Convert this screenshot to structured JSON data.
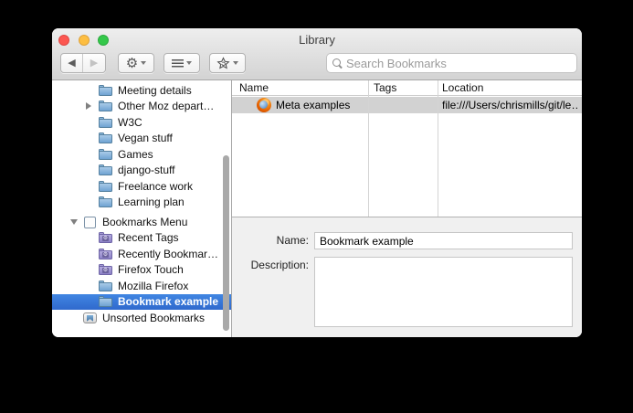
{
  "window": {
    "title": "Library"
  },
  "toolbar": {
    "back_icon": "◀",
    "forward_icon": "▶",
    "gear_icon": "⚙",
    "search_placeholder": "Search Bookmarks"
  },
  "sidebar": {
    "items": [
      {
        "label": "Meeting details",
        "icon": "folder",
        "level": 2,
        "disclosure": "none",
        "selected": false,
        "gap": false
      },
      {
        "label": "Other Moz depart…",
        "icon": "folder",
        "level": 2,
        "disclosure": "right",
        "selected": false,
        "gap": false
      },
      {
        "label": "W3C",
        "icon": "folder",
        "level": 2,
        "disclosure": "none",
        "selected": false,
        "gap": false
      },
      {
        "label": "Vegan stuff",
        "icon": "folder",
        "level": 2,
        "disclosure": "none",
        "selected": false,
        "gap": false
      },
      {
        "label": "Games",
        "icon": "folder",
        "level": 2,
        "disclosure": "none",
        "selected": false,
        "gap": false
      },
      {
        "label": "django-stuff",
        "icon": "folder",
        "level": 2,
        "disclosure": "none",
        "selected": false,
        "gap": false
      },
      {
        "label": "Freelance work",
        "icon": "folder",
        "level": 2,
        "disclosure": "none",
        "selected": false,
        "gap": false
      },
      {
        "label": "Learning plan",
        "icon": "folder",
        "level": 2,
        "disclosure": "none",
        "selected": false,
        "gap": false
      },
      {
        "label": "Bookmarks Menu",
        "icon": "menu",
        "level": 1,
        "disclosure": "down",
        "selected": false,
        "gap": true
      },
      {
        "label": "Recent Tags",
        "icon": "smart-folder",
        "level": 2,
        "disclosure": "none",
        "selected": false,
        "gap": false
      },
      {
        "label": "Recently Bookmar…",
        "icon": "smart-folder",
        "level": 2,
        "disclosure": "none",
        "selected": false,
        "gap": false
      },
      {
        "label": "Firefox Touch",
        "icon": "smart-folder",
        "level": 2,
        "disclosure": "none",
        "selected": false,
        "gap": false
      },
      {
        "label": "Mozilla Firefox",
        "icon": "folder",
        "level": 2,
        "disclosure": "none",
        "selected": false,
        "gap": false
      },
      {
        "label": "Bookmark example",
        "icon": "folder",
        "level": 2,
        "disclosure": "none",
        "selected": true,
        "gap": false
      },
      {
        "label": "Unsorted Bookmarks",
        "icon": "unsorted",
        "level": 1,
        "disclosure": "none",
        "selected": false,
        "gap": false
      }
    ]
  },
  "list": {
    "columns": [
      "Name",
      "Tags",
      "Location"
    ],
    "rows": [
      {
        "name": "Meta examples",
        "tags": "",
        "location": "file:///Users/chrismills/git/le…",
        "icon": "firefox"
      }
    ]
  },
  "details": {
    "name_label": "Name:",
    "name_value": "Bookmark example",
    "description_label": "Description:",
    "description_value": ""
  },
  "colors": {
    "selection_blue": "#3875d7",
    "inactive_selection_gray": "#d2d2d2",
    "titlebar_top": "#eeeeee",
    "titlebar_bottom": "#d3d3d3",
    "traffic_red": "#fc5650",
    "traffic_yellow": "#fdbe41",
    "traffic_green": "#34c84a"
  }
}
